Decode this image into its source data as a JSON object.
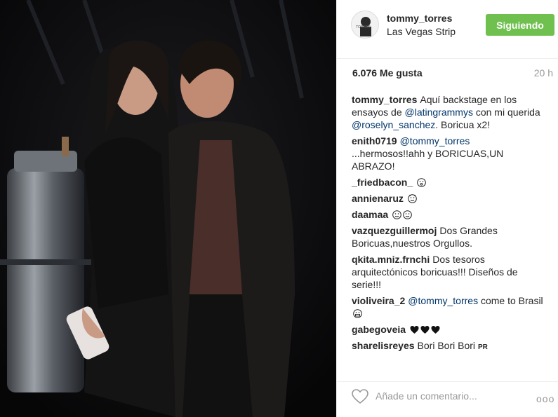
{
  "post": {
    "username": "tommy_torres",
    "location": "Las Vegas Strip",
    "follow_label": "Siguiendo",
    "likes": "6.076 Me gusta",
    "time": "20 h"
  },
  "comments": [
    {
      "user": "tommy_torres",
      "parts": [
        {
          "t": "Aquí backstage en los ensayos de "
        },
        {
          "t": "@latingrammys",
          "m": true
        },
        {
          "t": " con mi querida "
        },
        {
          "t": "@roselyn_sanchez",
          "m": true
        },
        {
          "t": ". Boricua x2!"
        }
      ]
    },
    {
      "user": "enith0719",
      "parts": [
        {
          "t": "@tommy_torres",
          "m": true
        },
        {
          "t": " ...hermosos!!ahh y BORICUAS,UN ABRAZO!"
        }
      ]
    },
    {
      "user": "_friedbacon_",
      "parts": [
        {
          "t": ""
        }
      ],
      "emoji": [
        "surprised-face"
      ]
    },
    {
      "user": "annienaruz",
      "parts": [
        {
          "t": ""
        }
      ],
      "emoji": [
        "cat-face"
      ]
    },
    {
      "user": "daamaa",
      "parts": [
        {
          "t": ""
        }
      ],
      "emoji": [
        "smile-face",
        "smile-face"
      ]
    },
    {
      "user": "vazquezguillermoj",
      "parts": [
        {
          "t": "Dos Grandes Boricuas,nuestros Orgullos."
        }
      ]
    },
    {
      "user": "qkita.mniz.frnchi",
      "parts": [
        {
          "t": "Dos tesoros arquitectónicos boricuas!!! Diseños de serie!!!"
        }
      ]
    },
    {
      "user": "violiveira_2",
      "parts": [
        {
          "t": "@tommy_torres",
          "m": true
        },
        {
          "t": " come to Brasil "
        }
      ],
      "emoji": [
        "grin-face"
      ]
    },
    {
      "user": "gabegoveia",
      "parts": [
        {
          "t": ""
        }
      ],
      "emoji": [
        "heart",
        "heart",
        "heart"
      ]
    },
    {
      "user": "sharelisreyes",
      "parts": [
        {
          "t": "Bori Bori Bori"
        }
      ],
      "badge": "PR"
    }
  ],
  "footer": {
    "comment_placeholder": "Añade un comentario...",
    "more_label": "ooo"
  },
  "colors": {
    "follow_green": "#70c050",
    "mention_blue": "#003569",
    "gray_text": "#999999"
  }
}
